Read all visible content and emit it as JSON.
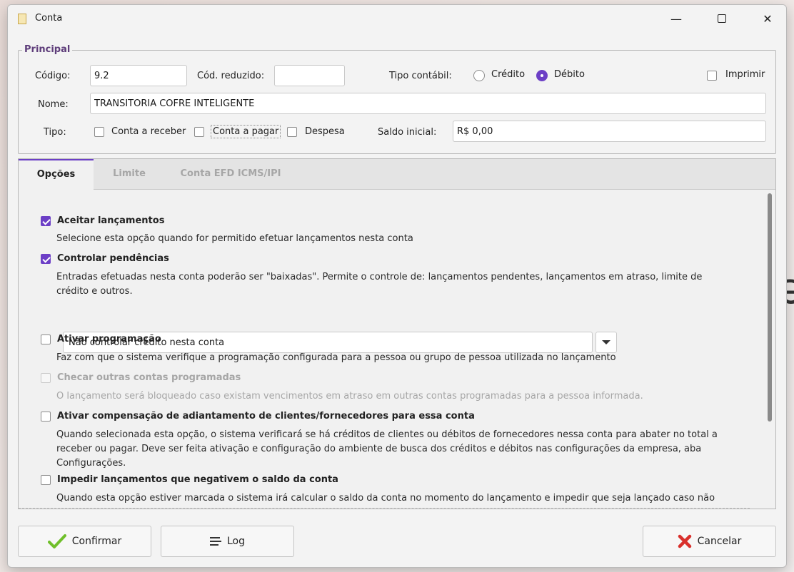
{
  "window": {
    "title": "Conta",
    "minimize_glyph": "—",
    "close_glyph": "✕"
  },
  "principal": {
    "group_title": "Principal",
    "codigo_label": "Código:",
    "codigo_value": "9.2",
    "cod_reduzido_label": "Cód. reduzido:",
    "cod_reduzido_value": "",
    "tipo_contabil_label": "Tipo contábil:",
    "credito_label": "Crédito",
    "debito_label": "Débito",
    "tipo_contabil_selected": "Débito",
    "imprimir_label": "Imprimir",
    "imprimir_checked": false,
    "nome_label": "Nome:",
    "nome_value": "TRANSITORIA COFRE INTELIGENTE",
    "tipo_label": "Tipo:",
    "tipo_options": [
      {
        "label": "Conta a receber",
        "checked": false
      },
      {
        "label": "Conta a pagar",
        "checked": false
      },
      {
        "label": "Despesa",
        "checked": false
      }
    ],
    "saldo_label": "Saldo inicial:",
    "saldo_value": "R$ 0,00"
  },
  "tabs": [
    {
      "label": "Opções",
      "active": true
    },
    {
      "label": "Limite",
      "active": false
    },
    {
      "label": "Conta EFD ICMS/IPI",
      "active": false
    }
  ],
  "options": [
    {
      "title": "Aceitar lançamentos",
      "checked": true,
      "enabled": true,
      "desc": "Selecione esta opção quando for permitido efetuar lançamentos nesta conta"
    },
    {
      "title": "Controlar pendências",
      "checked": true,
      "enabled": true,
      "desc_line1": "Entradas efetuadas nesta conta poderão ser \"baixadas\". Permite o controle de: lançamentos pendentes, lançamentos em atraso, limite de",
      "desc_line2": "crédito e outros."
    },
    {
      "title": "Ativar programação",
      "checked": false,
      "enabled": true,
      "desc": "Faz com que o sistema verifique a programação configurada para a pessoa ou grupo de pessoa utilizada no lançamento"
    },
    {
      "title": "Checar outras contas programadas",
      "checked": false,
      "enabled": false,
      "desc": "O lançamento será bloqueado caso existam vencimentos em atraso em outras contas programadas para a pessoa informada."
    },
    {
      "title": "Ativar compensação de adiantamento de clientes/fornecedores para essa conta",
      "checked": false,
      "enabled": true,
      "desc_line1": "Quando  selecionada esta opção, o sistema verificará se há créditos de clientes ou débitos de fornecedores nessa conta para abater no total a",
      "desc_line2": "receber ou pagar. Deve ser feita ativação e configuração do ambiente de busca dos créditos e débitos nas configurações da empresa, aba",
      "desc_line3": "Configurações."
    },
    {
      "title": "Impedir lançamentos que negativem o saldo da conta",
      "checked": false,
      "enabled": true,
      "desc": "Quando esta opção estiver marcada o sistema irá calcular o saldo da conta no momento do lançamento e impedir que seja lançado caso não"
    }
  ],
  "credit_combo": {
    "selected": "Não controlar crédito nesta conta"
  },
  "buttons": {
    "confirmar": "Confirmar",
    "log": "Log",
    "cancelar": "Cancelar"
  },
  "colors": {
    "accent": "#6c3fc6",
    "group_title": "#5e3d7a",
    "confirm_icon": "#6fbf2a",
    "cancel_icon": "#d9302c"
  }
}
